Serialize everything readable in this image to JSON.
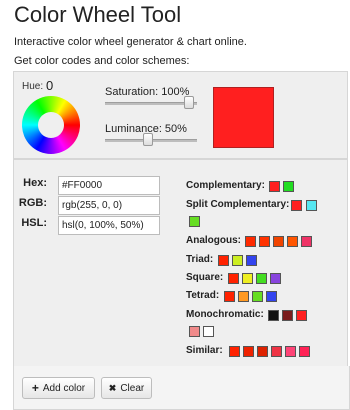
{
  "header": {
    "title": "Color Wheel Tool",
    "subtitle": "Interactive color wheel generator & chart online.",
    "subtitle2": "Get color codes and color schemes:"
  },
  "wheel": {
    "hue_label": "Hue:",
    "hue_value": "0"
  },
  "sliders": {
    "saturation_label": "Saturation: 100%",
    "luminance_label": "Luminance: 50%",
    "saturation_value": 100,
    "luminance_value": 50
  },
  "preview": {
    "color": "#ff1f1f"
  },
  "fields": {
    "hex_label": "Hex:",
    "hex_value": "#FF0000",
    "rgb_label": "RGB:",
    "rgb_value": "rgb(255, 0, 0)",
    "hsl_label": "HSL:",
    "hsl_value": "hsl(0, 100%, 50%)"
  },
  "schemes": {
    "complementary": {
      "label": "Complementary:",
      "colors": [
        "#ff1f1f",
        "#22dd22"
      ]
    },
    "split": {
      "label": "Split Complementary:",
      "colors": [
        "#ff1f1f",
        "#55e6f0",
        "#66dd22"
      ]
    },
    "analogous": {
      "label": "Analogous:",
      "colors": [
        "#ff2a00",
        "#ff3300",
        "#f04400",
        "#ff5500",
        "#ee3366"
      ]
    },
    "triad": {
      "label": "Triad:",
      "colors": [
        "#ff2200",
        "#ccee22",
        "#3344ee"
      ]
    },
    "square": {
      "label": "Square:",
      "colors": [
        "#ff2200",
        "#eeee22",
        "#44dd22",
        "#8844dd"
      ]
    },
    "tetrad": {
      "label": "Tetrad:",
      "colors": [
        "#ff2200",
        "#ff9922",
        "#66dd22",
        "#3344ee"
      ]
    },
    "monochromatic": {
      "label": "Monochromatic:",
      "colors": [
        "#111111",
        "#7a1c1c",
        "#ff1f1f",
        "#f08a8a",
        "#ffffff"
      ]
    },
    "similar": {
      "label": "Similar:",
      "colors": [
        "#ff2200",
        "#ee2200",
        "#dd2200",
        "#ee3344",
        "#ff4477",
        "#ff2255"
      ]
    }
  },
  "buttons": {
    "add_label": "Add color",
    "clear_label": "Clear"
  }
}
